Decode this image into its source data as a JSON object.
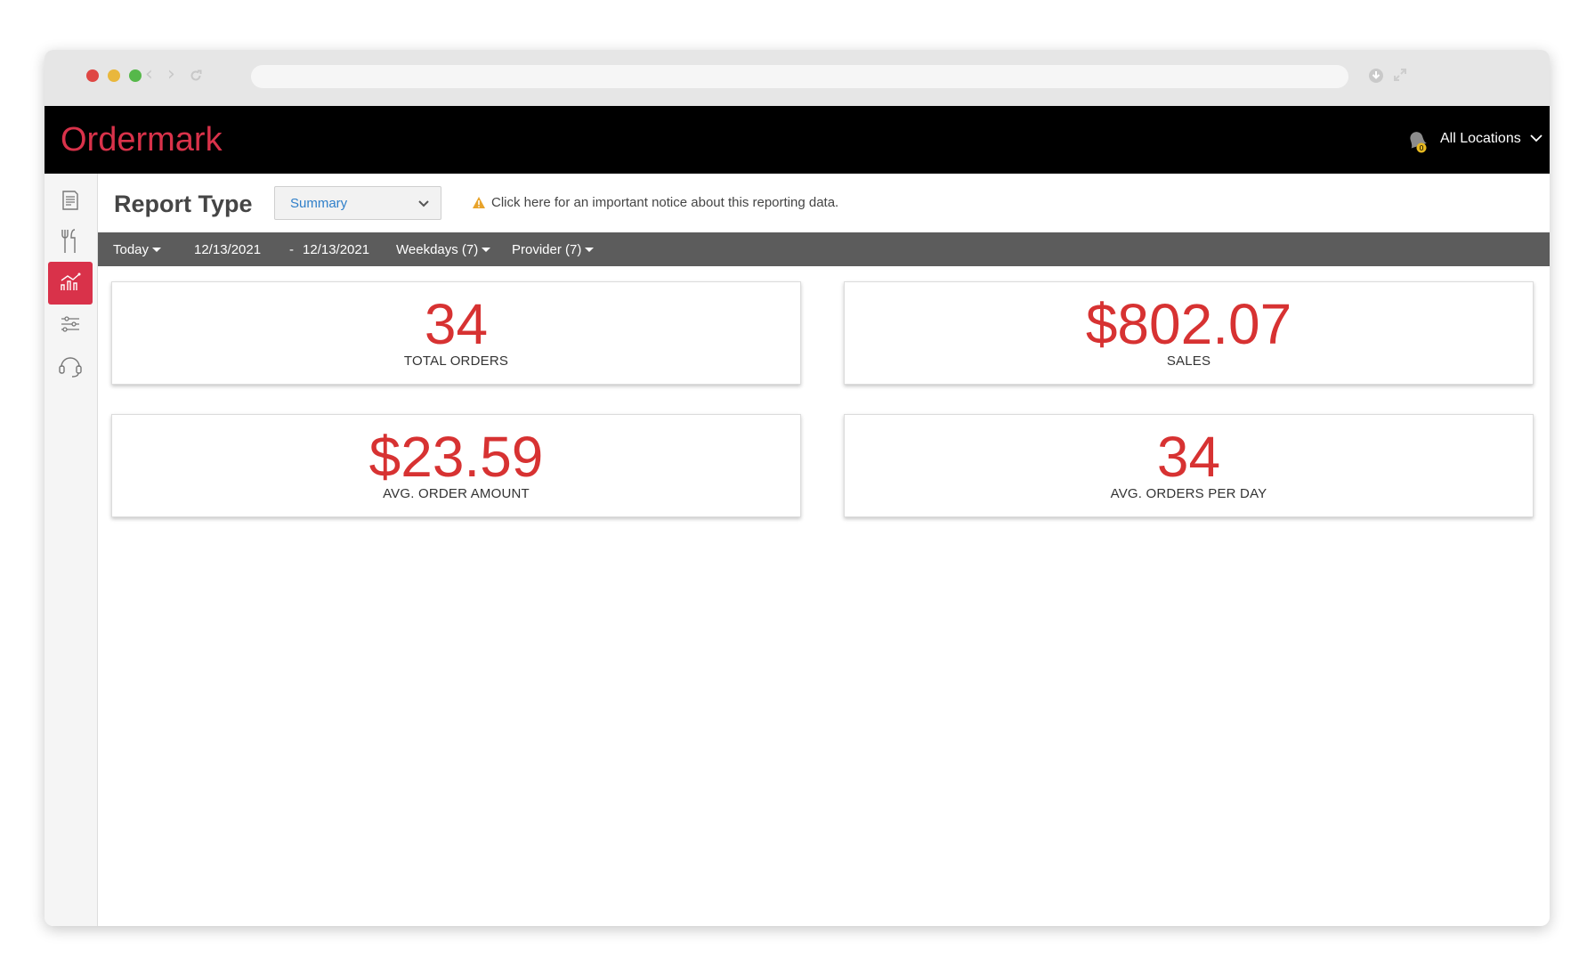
{
  "app": {
    "brand": "Ordermark",
    "location_selector": "All Locations",
    "notification_count": "0"
  },
  "report": {
    "title": "Report Type",
    "type_value": "Summary",
    "notice": "Click here for an important notice about this reporting data."
  },
  "filters": {
    "range": "Today",
    "start_date": "12/13/2021",
    "separator": "-",
    "end_date": "12/13/2021",
    "weekdays": "Weekdays (7)",
    "provider": "Provider (7)"
  },
  "cards": [
    {
      "value": "34",
      "label": "TOTAL ORDERS"
    },
    {
      "value": "$802.07",
      "label": "SALES"
    },
    {
      "value": "$23.59",
      "label": "AVG. ORDER AMOUNT"
    },
    {
      "value": "34",
      "label": "AVG. ORDERS PER DAY"
    }
  ],
  "sidebar": {
    "items": [
      {
        "icon": "receipt-icon"
      },
      {
        "icon": "utensils-icon"
      },
      {
        "icon": "bar-chart-icon",
        "active": true
      },
      {
        "icon": "sliders-icon"
      },
      {
        "icon": "headset-icon"
      }
    ]
  },
  "colors": {
    "brand_red": "#d9324a",
    "metric_red": "#d73232",
    "header_bg": "#000000",
    "filter_bar": "#5c5c5c",
    "link_blue": "#2f7fc9",
    "warning": "#e8a32b"
  }
}
